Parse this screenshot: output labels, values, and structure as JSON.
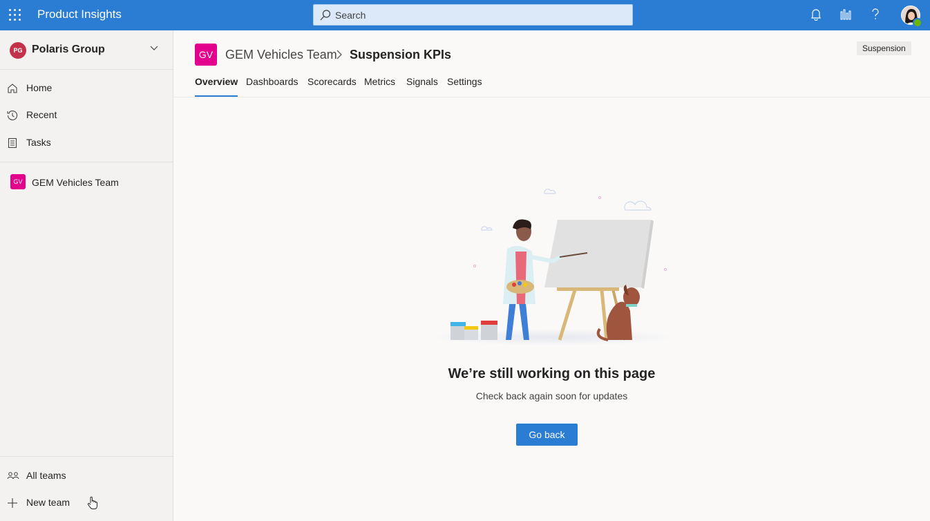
{
  "app": {
    "title": "Product Insights"
  },
  "search": {
    "placeholder": "Search"
  },
  "sidebar": {
    "org": {
      "initials": "PG",
      "name": "Polaris Group"
    },
    "nav": [
      {
        "label": "Home",
        "icon": "home-icon"
      },
      {
        "label": "Recent",
        "icon": "history-icon"
      },
      {
        "label": "Tasks",
        "icon": "tasks-icon"
      }
    ],
    "team": {
      "initials": "GV",
      "name": "GEM Vehicles Team"
    },
    "footer": [
      {
        "label": "All teams",
        "icon": "people-icon"
      },
      {
        "label": "New team",
        "icon": "plus-icon"
      }
    ]
  },
  "header": {
    "team_initials": "GV",
    "team_name": "GEM Vehicles Team",
    "page_title": "Suspension KPIs",
    "tag": "Suspension",
    "tabs": [
      "Overview",
      "Dashboards",
      "Scorecards",
      "Metrics",
      "Signals",
      "Settings"
    ],
    "active_tab": "Overview"
  },
  "empty_state": {
    "title": "We’re still working on this page",
    "subtitle": "Check back again soon for updates",
    "button": "Go back"
  },
  "colors": {
    "accent": "#2b7cd3",
    "team": "#e3008c",
    "org": "#c4314b"
  }
}
